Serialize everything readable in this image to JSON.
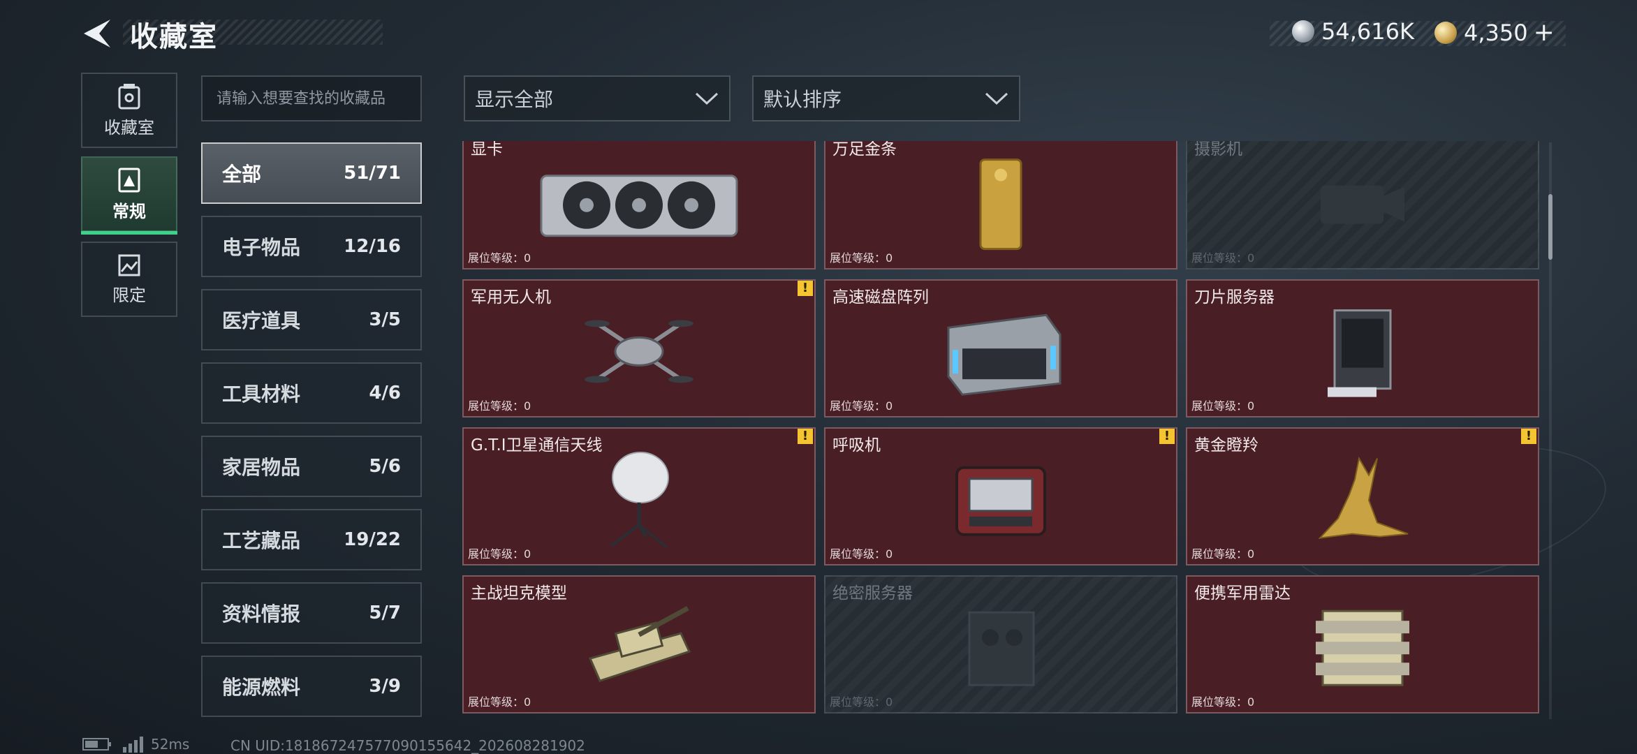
{
  "header": {
    "title": "收藏室",
    "currency_silver": "54,616K",
    "currency_gold": "4,350",
    "plus": "+"
  },
  "side_tabs": [
    {
      "label": "收藏室",
      "icon": "vault-icon"
    },
    {
      "label": "常规",
      "icon": "exhibit-icon",
      "active": true
    },
    {
      "label": "限定",
      "icon": "picture-icon"
    }
  ],
  "search": {
    "placeholder": "请输入想要查找的收藏品"
  },
  "filters": {
    "display": "显示全部",
    "sort": "默认排序"
  },
  "categories": [
    {
      "name": "全部",
      "count": "51/71",
      "active": true
    },
    {
      "name": "电子物品",
      "count": "12/16"
    },
    {
      "name": "医疗道具",
      "count": "3/5"
    },
    {
      "name": "工具材料",
      "count": "4/6"
    },
    {
      "name": "家居物品",
      "count": "5/6"
    },
    {
      "name": "工艺藏品",
      "count": "19/22"
    },
    {
      "name": "资料情报",
      "count": "5/7"
    },
    {
      "name": "能源燃料",
      "count": "3/9"
    }
  ],
  "level_label": "展位等级：0",
  "items": [
    {
      "name": "显卡",
      "locked": false,
      "warn": false,
      "icon": "gpu-icon"
    },
    {
      "name": "万足金条",
      "locked": false,
      "warn": false,
      "icon": "gold-bar-icon"
    },
    {
      "name": "摄影机",
      "locked": true,
      "warn": false,
      "icon": "camera-icon"
    },
    {
      "name": "军用无人机",
      "locked": false,
      "warn": true,
      "icon": "drone-icon"
    },
    {
      "name": "高速磁盘阵列",
      "locked": false,
      "warn": false,
      "icon": "disk-array-icon"
    },
    {
      "name": "刀片服务器",
      "locked": false,
      "warn": false,
      "icon": "server-icon"
    },
    {
      "name": "G.T.I卫星通信天线",
      "locked": false,
      "warn": true,
      "icon": "satellite-dish-icon"
    },
    {
      "name": "呼吸机",
      "locked": false,
      "warn": true,
      "icon": "ventilator-icon"
    },
    {
      "name": "黄金瞪羚",
      "locked": false,
      "warn": true,
      "icon": "gazelle-icon"
    },
    {
      "name": "主战坦克模型",
      "locked": false,
      "warn": false,
      "icon": "tank-icon"
    },
    {
      "name": "绝密服务器",
      "locked": true,
      "warn": false,
      "icon": "secret-server-icon"
    },
    {
      "name": "便携军用雷达",
      "locked": false,
      "warn": false,
      "icon": "radar-icon"
    }
  ],
  "footer": {
    "ping": "52ms",
    "uid": "CN UID:1818672475770901556​42_202608281902"
  }
}
